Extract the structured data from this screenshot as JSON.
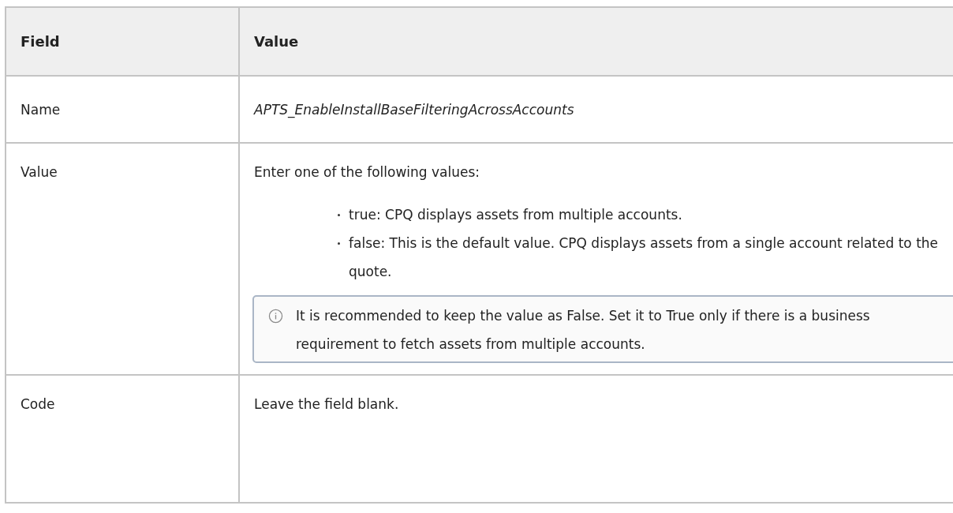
{
  "table": {
    "columns": [
      "Field",
      "Value"
    ],
    "rows": [
      {
        "field": "Name",
        "kind": "italic",
        "value": "APTS_EnableInstallBaseFilteringAcrossAccounts"
      },
      {
        "field": "Value",
        "kind": "list",
        "value": "Enter one of the following values:",
        "items": [
          "true: CPQ displays assets from multiple accounts.",
          "false: This is the default value. CPQ displays assets from a single account related to the quote."
        ],
        "note": "It is recommended to keep the value as False. Set it to True only if there is a business requirement to fetch assets from multiple accounts."
      },
      {
        "field": "Code",
        "kind": "plain",
        "value": "Leave the field blank."
      }
    ]
  }
}
